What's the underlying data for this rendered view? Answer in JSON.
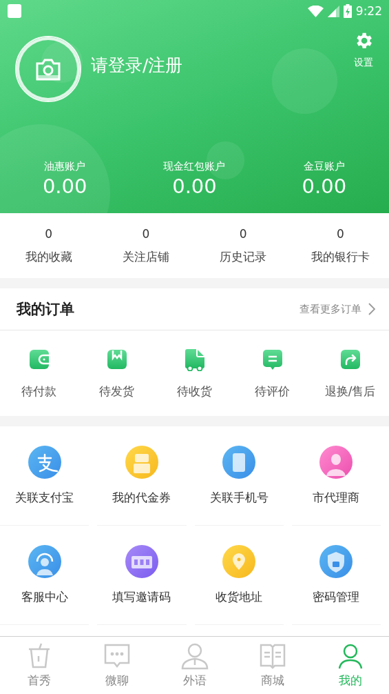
{
  "status_bar": {
    "time": "9:22"
  },
  "header": {
    "login": "请登录/注册",
    "settings": "设置",
    "accounts": [
      {
        "label": "油惠账户",
        "value": "0.00"
      },
      {
        "label": "现金红包账户",
        "value": "0.00"
      },
      {
        "label": "金豆账户",
        "value": "0.00"
      }
    ]
  },
  "stats": [
    {
      "count": "0",
      "label": "我的收藏"
    },
    {
      "count": "0",
      "label": "关注店铺"
    },
    {
      "count": "0",
      "label": "历史记录"
    },
    {
      "count": "0",
      "label": "我的银行卡"
    }
  ],
  "orders": {
    "title": "我的订单",
    "more": "查看更多订单",
    "items": [
      {
        "kind": "wallet",
        "label": "待付款"
      },
      {
        "kind": "box",
        "label": "待发货"
      },
      {
        "kind": "truck",
        "label": "待收货"
      },
      {
        "kind": "comment",
        "label": "待评价"
      },
      {
        "kind": "return",
        "label": "退换/售后"
      }
    ]
  },
  "services": [
    {
      "kind": "alipay",
      "label": "关联支付宝"
    },
    {
      "kind": "coupon",
      "label": "我的代金券"
    },
    {
      "kind": "phone",
      "label": "关联手机号"
    },
    {
      "kind": "agent",
      "label": "市代理商"
    },
    {
      "kind": "support",
      "label": "客服中心"
    },
    {
      "kind": "code",
      "label": "填写邀请码"
    },
    {
      "kind": "address",
      "label": "收货地址"
    },
    {
      "kind": "password",
      "label": "密码管理"
    }
  ],
  "tabs": [
    {
      "kind": "cup",
      "label": "首秀",
      "selected": false
    },
    {
      "kind": "chat",
      "label": "微聊",
      "selected": false
    },
    {
      "kind": "person",
      "label": "外语",
      "selected": false
    },
    {
      "kind": "book",
      "label": "商城",
      "selected": false
    },
    {
      "kind": "user",
      "label": "我的",
      "selected": true
    }
  ]
}
